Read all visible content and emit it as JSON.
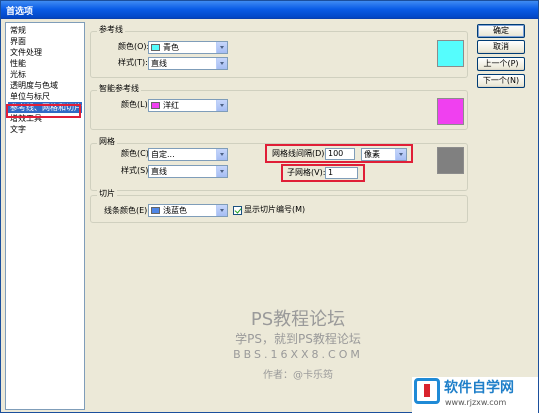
{
  "window": {
    "title": "首选项"
  },
  "categories": [
    {
      "label": "常规",
      "selected": false
    },
    {
      "label": "界面",
      "selected": false
    },
    {
      "label": "文件处理",
      "selected": false
    },
    {
      "label": "性能",
      "selected": false
    },
    {
      "label": "光标",
      "selected": false
    },
    {
      "label": "透明度与色域",
      "selected": false
    },
    {
      "label": "单位与标尺",
      "selected": false
    },
    {
      "label": "参考线、网格和切片",
      "selected": true
    },
    {
      "label": "增效工具",
      "selected": false
    },
    {
      "label": "文字",
      "selected": false
    }
  ],
  "guides": {
    "title": "参考线",
    "color_label": "颜色(O):",
    "color_value": "青色",
    "color_hex": "#55fdfd",
    "style_label": "样式(T):",
    "style_value": "直线"
  },
  "smart_guides": {
    "title": "智能参考线",
    "color_label": "颜色(L):",
    "color_value": "洋红",
    "color_hex": "#f040f0"
  },
  "grid": {
    "title": "网格",
    "color_label": "颜色(C):",
    "color_value": "自定...",
    "color_hex": "#808080",
    "style_label": "样式(S):",
    "style_value": "直线",
    "gridline_label": "网格线间隔(D):",
    "gridline_value": "100",
    "unit_value": "像素",
    "subdiv_label": "子网格(V):",
    "subdiv_value": "1"
  },
  "slices": {
    "title": "切片",
    "line_color_label": "线条颜色(E):",
    "line_color_value": "浅蓝色",
    "line_color_hex": "#4f86e6",
    "show_numbers_label": "显示切片编号(M)",
    "show_numbers_checked": true
  },
  "buttons": {
    "ok": "确定",
    "cancel": "取消",
    "prev": "上一个(P)",
    "next": "下一个(N)"
  },
  "watermark": {
    "line1": "PS教程论坛",
    "line2": "学PS，就到PS教程论坛",
    "line3": "BBS.16XX8.COM",
    "line4": "作者：@卡乐筠"
  },
  "logo": {
    "line1": "软件自学网",
    "line2": "www.rjzxw.com"
  },
  "highlight_color": "#e01e37"
}
